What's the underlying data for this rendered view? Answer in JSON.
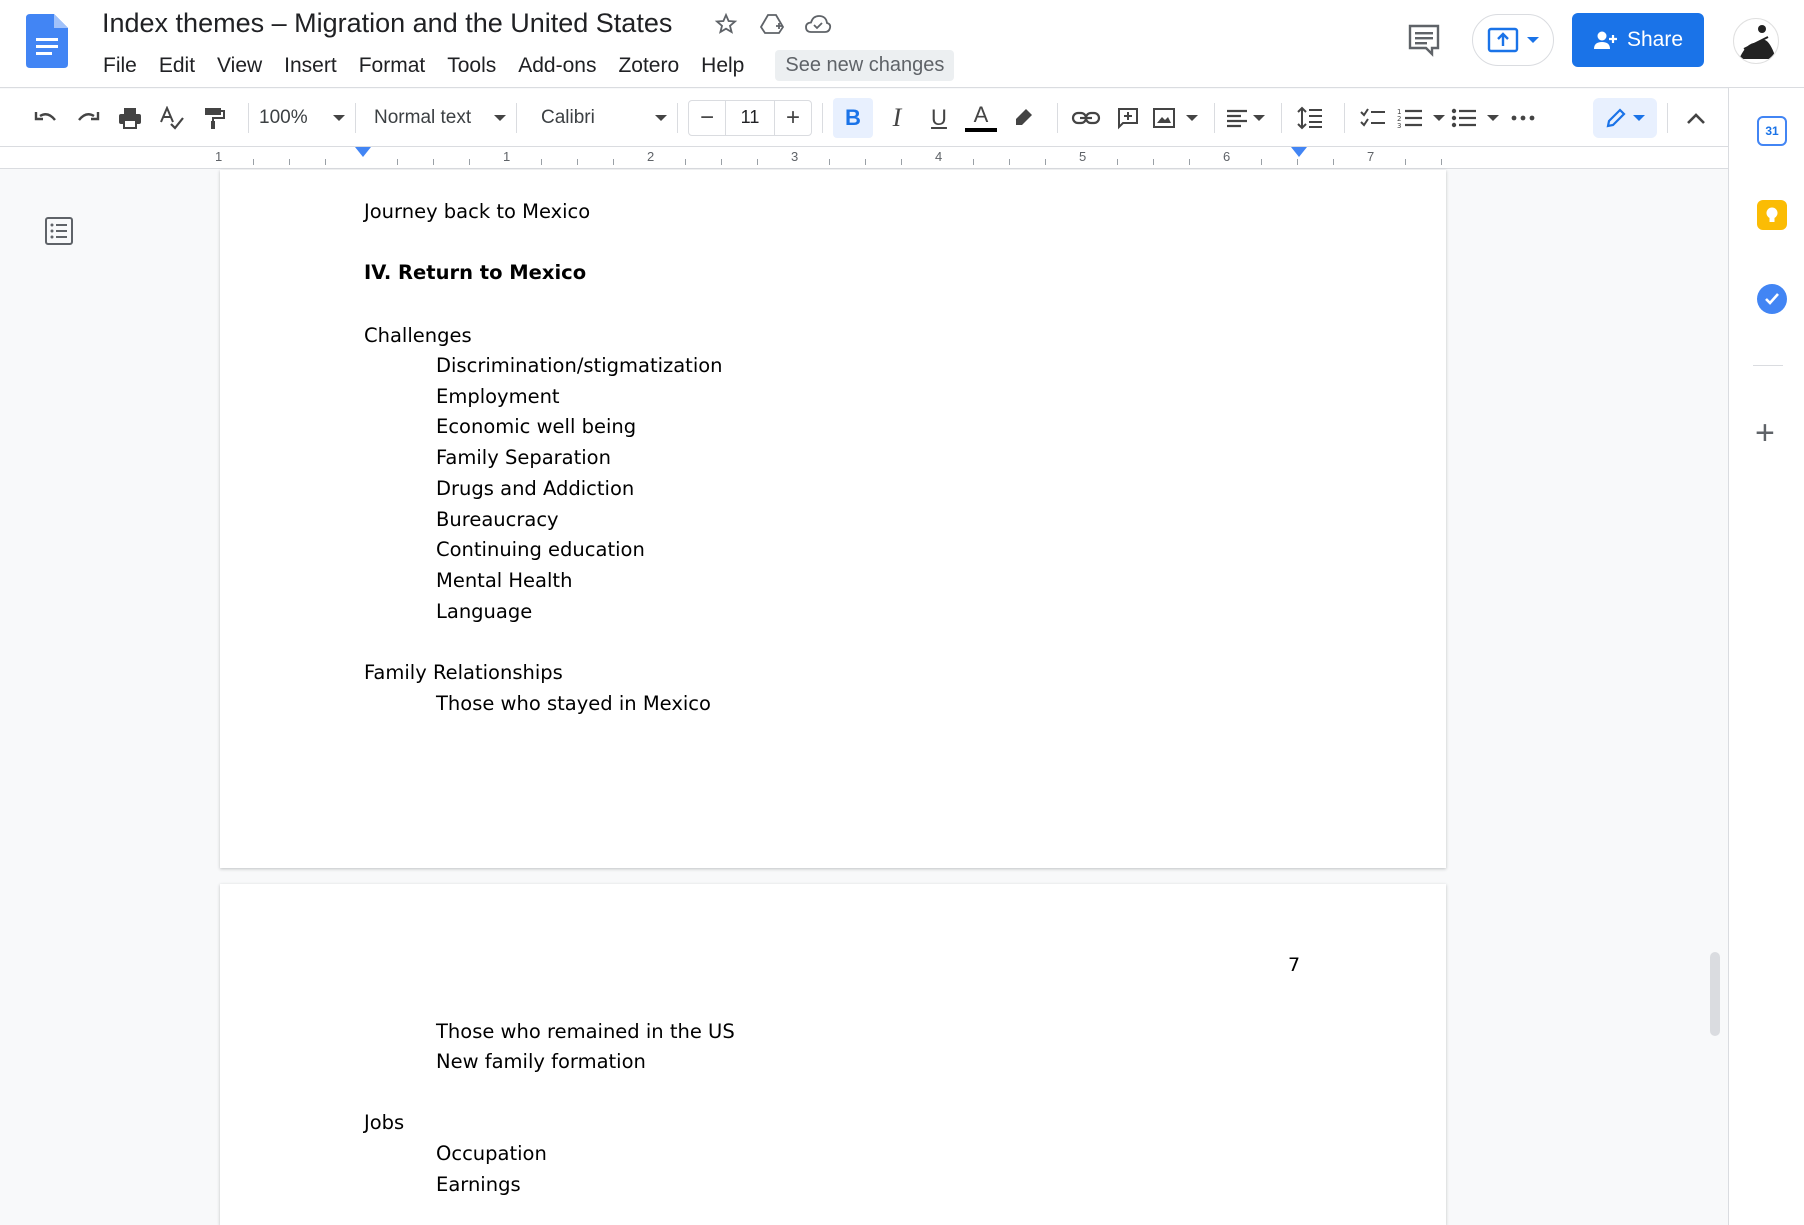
{
  "doc": {
    "title": "Index themes – Migration and the United States",
    "menus": [
      "File",
      "Edit",
      "View",
      "Insert",
      "Format",
      "Tools",
      "Add-ons",
      "Zotero",
      "Help"
    ],
    "see_changes": "See new changes"
  },
  "header": {
    "share_label": "Share"
  },
  "toolbar": {
    "zoom": "100%",
    "style": "Normal text",
    "font": "Calibri",
    "font_size": "11",
    "bold": "B",
    "italic": "I",
    "underline": "U",
    "text_color": "A"
  },
  "ruler": {
    "labels": [
      "1",
      "1",
      "2",
      "3",
      "4",
      "5",
      "6",
      "7"
    ]
  },
  "page1": {
    "lines": [
      {
        "text": "Journey back to Mexico",
        "indent": 0,
        "bold": false
      },
      {
        "text": "IV. Return to Mexico",
        "indent": 0,
        "bold": true
      },
      {
        "text": "Challenges",
        "indent": 0,
        "bold": false
      },
      {
        "text": "Discrimination/stigmatization",
        "indent": 1,
        "bold": false
      },
      {
        "text": "Employment",
        "indent": 1,
        "bold": false
      },
      {
        "text": "Economic well being",
        "indent": 1,
        "bold": false
      },
      {
        "text": "Family Separation",
        "indent": 1,
        "bold": false
      },
      {
        "text": "Drugs and Addiction",
        "indent": 1,
        "bold": false
      },
      {
        "text": "Bureaucracy",
        "indent": 1,
        "bold": false
      },
      {
        "text": "Continuing education",
        "indent": 1,
        "bold": false
      },
      {
        "text": "Mental Health",
        "indent": 1,
        "bold": false
      },
      {
        "text": "Language",
        "indent": 1,
        "bold": false
      },
      {
        "text": "Family Relationships",
        "indent": 0,
        "bold": false
      },
      {
        "text": "Those who stayed in Mexico",
        "indent": 1,
        "bold": false
      }
    ]
  },
  "page2": {
    "page_number": "7",
    "lines": [
      {
        "text": "Those who remained in the US",
        "indent": 1,
        "bold": false
      },
      {
        "text": "New family formation",
        "indent": 1,
        "bold": false
      },
      {
        "text": "Jobs",
        "indent": 0,
        "bold": false
      },
      {
        "text": "Occupation",
        "indent": 1,
        "bold": false
      },
      {
        "text": "Earnings",
        "indent": 1,
        "bold": false
      }
    ]
  },
  "side_panel": {
    "calendar_day": "31"
  },
  "colors": {
    "accent": "#1a73e8",
    "keep": "#fbbc04",
    "tasks": "#4285f4"
  }
}
